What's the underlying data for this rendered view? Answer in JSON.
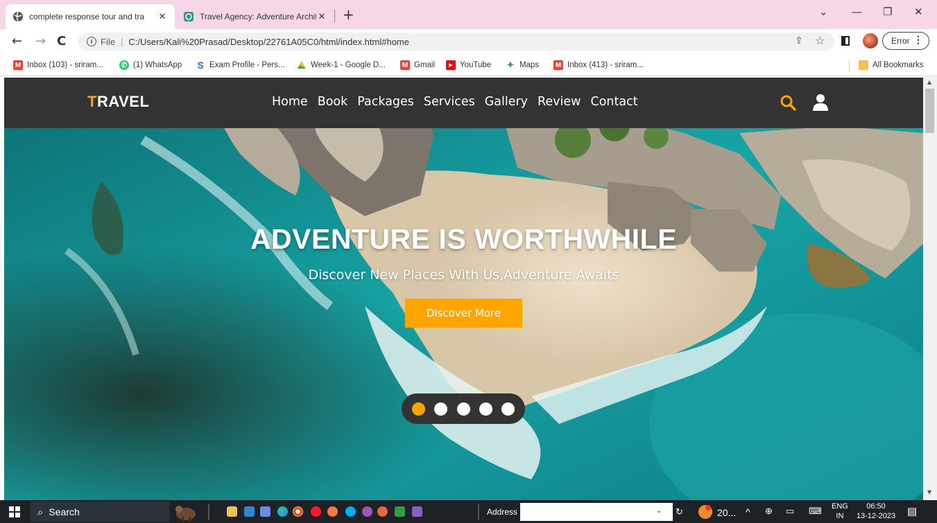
{
  "browser": {
    "tabs": [
      {
        "title": "complete response tour and tra",
        "active": true
      },
      {
        "title": "Travel Agency: Adventure Archit",
        "active": false
      }
    ],
    "url_scheme": "File",
    "url": "C:/Users/Kali%20Prasad/Desktop/22761A05C0/html/index.html#home",
    "error_label": "Error",
    "bookmarks": [
      {
        "label": "Inbox (103) - sriram...",
        "icon": "gmail-icon",
        "color": "#ea4335"
      },
      {
        "label": "(1) WhatsApp",
        "icon": "whatsapp-icon",
        "color": "#25d366"
      },
      {
        "label": "Exam Profile - Pers...",
        "icon": "s-icon",
        "color": "#1e6ec8"
      },
      {
        "label": "Week-1 - Google D...",
        "icon": "drive-icon",
        "color": "#fbbc04"
      },
      {
        "label": "Gmail",
        "icon": "gmail-icon",
        "color": "#ea4335"
      },
      {
        "label": "YouTube",
        "icon": "youtube-icon",
        "color": "#ff0000"
      },
      {
        "label": "Maps",
        "icon": "maps-icon",
        "color": "#34a853"
      },
      {
        "label": "Inbox (413) - sriram...",
        "icon": "gmail-icon",
        "color": "#ea4335"
      }
    ],
    "all_bookmarks": "All Bookmarks"
  },
  "site": {
    "logo_first": "T",
    "logo_rest": "RAVEL",
    "nav": [
      "Home",
      "Book",
      "Packages",
      "Services",
      "Gallery",
      "Review",
      "Contact"
    ],
    "hero_title": "ADVENTURE IS WORTHWHILE",
    "hero_subtitle": "Discover New Places With Us,Adventure Awaits",
    "cta": "Discover More",
    "slides_count": 5,
    "active_slide": 1,
    "accent": "#ffa500",
    "header_bg": "#333333"
  },
  "taskbar": {
    "search": "Search",
    "address_label": "Address",
    "weather": "20...",
    "lang_top": "ENG",
    "lang_bottom": "IN",
    "time": "06:50",
    "date": "13-12-2023"
  }
}
